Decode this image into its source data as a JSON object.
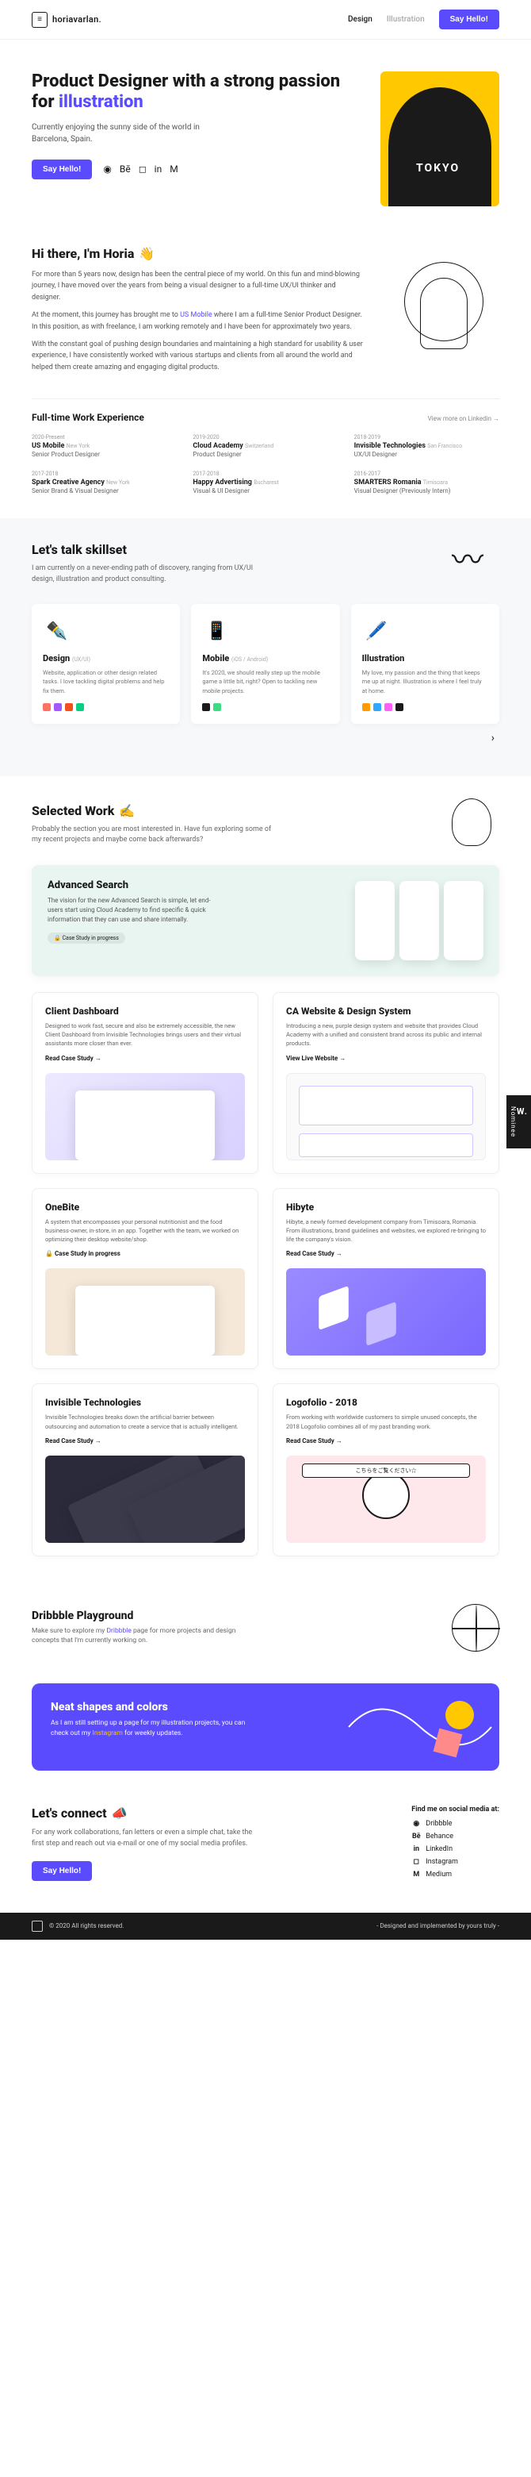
{
  "header": {
    "logo_text": "horiavarlan.",
    "nav": {
      "design": "Design",
      "illustration": "Illustration"
    },
    "cta": "Say Hello!"
  },
  "hero": {
    "title_a": "Product Designer with a strong passion for ",
    "title_b": "illustration",
    "sub": "Currently enjoying the sunny side of the world in Barcelona, Spain.",
    "cta": "Say Hello!",
    "tokyo": "TOKYO"
  },
  "intro": {
    "title": "Hi there, I'm Horia",
    "emoji": "👋",
    "p1": "For more than 5 years now, design has been the central piece of my world. On this fun and mind-blowing journey, I have moved over the years from being a visual designer to a full-time UX/UI thinker and designer.",
    "p2a": "At the moment, this journey has brought me to ",
    "p2b": "US Mobile",
    "p2c": " where I am a full-time Senior Product Designer. In this position, as with freelance, I am working remotely and I have been for approximately two years.",
    "p3": "With the constant goal of pushing design boundaries and maintaining a high standard for usability & user experience, I have consistently worked with various startups and clients from all around the world and helped them create amazing and engaging digital products."
  },
  "exp": {
    "title": "Full-time Work Experience",
    "more": "View more on Linkedin →",
    "items": [
      {
        "date": "2020-Present",
        "company": "US Mobile",
        "loc": "New York",
        "role": "Senior Product Designer"
      },
      {
        "date": "2019-2020",
        "company": "Cloud Academy",
        "loc": "Switzerland",
        "role": "Product Designer"
      },
      {
        "date": "2018-2019",
        "company": "Invisible Technologies",
        "loc": "San Francisco",
        "role": "UX/UI Designer"
      },
      {
        "date": "2017-2018",
        "company": "Spark Creative Agency",
        "loc": "New York",
        "role": "Senior Brand & Visual Designer"
      },
      {
        "date": "2017-2018",
        "company": "Happy Advertising",
        "loc": "Bucharest",
        "role": "Visual & UI Designer"
      },
      {
        "date": "2016-2017",
        "company": "SMARTERS Romania",
        "loc": "Timisoara",
        "role": "Visual Designer (Previously Intern)"
      }
    ]
  },
  "skills": {
    "title": "Let's talk skillset",
    "sub": "I am currently on a never-ending path of discovery, ranging from UX/UI design, illustration and product consulting.",
    "cards": [
      {
        "title": "Design",
        "tag": "(UX/UI)",
        "body": "Website, application or other design related tasks. I love tackling digital problems and help fix them.",
        "tools": [
          "#FF7262",
          "#A259FF",
          "#F24E1E",
          "#0ACF83"
        ]
      },
      {
        "title": "Mobile",
        "tag": "(iOS / Android)",
        "body": "It's 2020, we should really step up the mobile game a little bit, right? Open to tackling new mobile projects.",
        "tools": [
          "#1a1a1a",
          "#3DDC84"
        ]
      },
      {
        "title": "Illustration",
        "tag": "",
        "body": "My love, my passion and the thing that keeps me up at night. Illustration is where I feel truly at home.",
        "tools": [
          "#FF9A00",
          "#31A8FF",
          "#FF61F6",
          "#1a1a1a"
        ]
      }
    ]
  },
  "work": {
    "title": "Selected Work",
    "emoji": "✍️",
    "sub": "Probably the section you are most interested in. Have fun exploring some of my recent projects and maybe come back afterwards?",
    "featured": {
      "title": "Advanced Search",
      "body": "The vision for the new Advanced Search is simple, let end-users start using Cloud Academy to find specific & quick information that they can use and share internally.",
      "pill": "🔒 Case Study in progress"
    },
    "cards": [
      {
        "title": "Client Dashboard",
        "body": "Designed to work fast, secure and also be extremely accessible, the new Client Dashboard from Invisible Technologies brings users and their virtual assistants more closer than ever.",
        "link": "Read Case Study →"
      },
      {
        "title": "CA Website & Design System",
        "body": "Introducing a new, purple design system and website that provides Cloud Academy with a unified and consistent brand across its public and internal products.",
        "link": "View Live Website →"
      },
      {
        "title": "OneBite",
        "body": "A system that encompasses your personal nutritionist and the food business-owner, in-store, in an app. Together with the team, we worked on optimizing their desktop website/shop.",
        "link": "🔒 Case Study in progress"
      },
      {
        "title": "Hibyte",
        "body": "Hibyte, a newly formed development company from Timisoara, Romania. From illustrations, brand guidelines and websites, we explored re-bringing to life the company's vision.",
        "link": "Read Case Study →"
      },
      {
        "title": "Invisible Technologies",
        "body": "Invisible Technologies breaks down the artificial barrier between outsourcing and automation to create a service that is actually intelligent.",
        "link": "Read Case Study →"
      },
      {
        "title": "Logofolio - 2018",
        "body": "From working with worldwide customers to simple unused concepts, the 2018 Logofolio combines all of my past branding work.",
        "link": "Read Case Study →"
      }
    ]
  },
  "dribbble": {
    "title": "Dribbble Playground",
    "body_a": "Make sure to explore my ",
    "body_b": "Dribbble",
    "body_c": " page for more projects and design concepts that I'm currently working on."
  },
  "neat": {
    "title": "Neat shapes and colors",
    "body_a": "As I am still setting up a page for my illustration projects, you can check out my ",
    "body_b": "Instagram",
    "body_c": " for weekly updates."
  },
  "connect": {
    "title": "Let's connect",
    "emoji": "📣",
    "body": "For any work collaborations, fan letters or even a simple chat, take the first step and reach out via e-mail or one of my social media profiles.",
    "cta": "Say Hello!",
    "sm_title": "Find me on social media at:",
    "sm": [
      {
        "icon": "◉",
        "label": "Dribbble"
      },
      {
        "icon": "Bē",
        "label": "Behance"
      },
      {
        "icon": "in",
        "label": "LinkedIn"
      },
      {
        "icon": "◻",
        "label": "Instagram"
      },
      {
        "icon": "M",
        "label": "Medium"
      }
    ]
  },
  "footer": {
    "left": "© 2020 All rights reserved.",
    "right": "- Designed and implemented by yours truly -"
  },
  "awwwards": "Nominee"
}
